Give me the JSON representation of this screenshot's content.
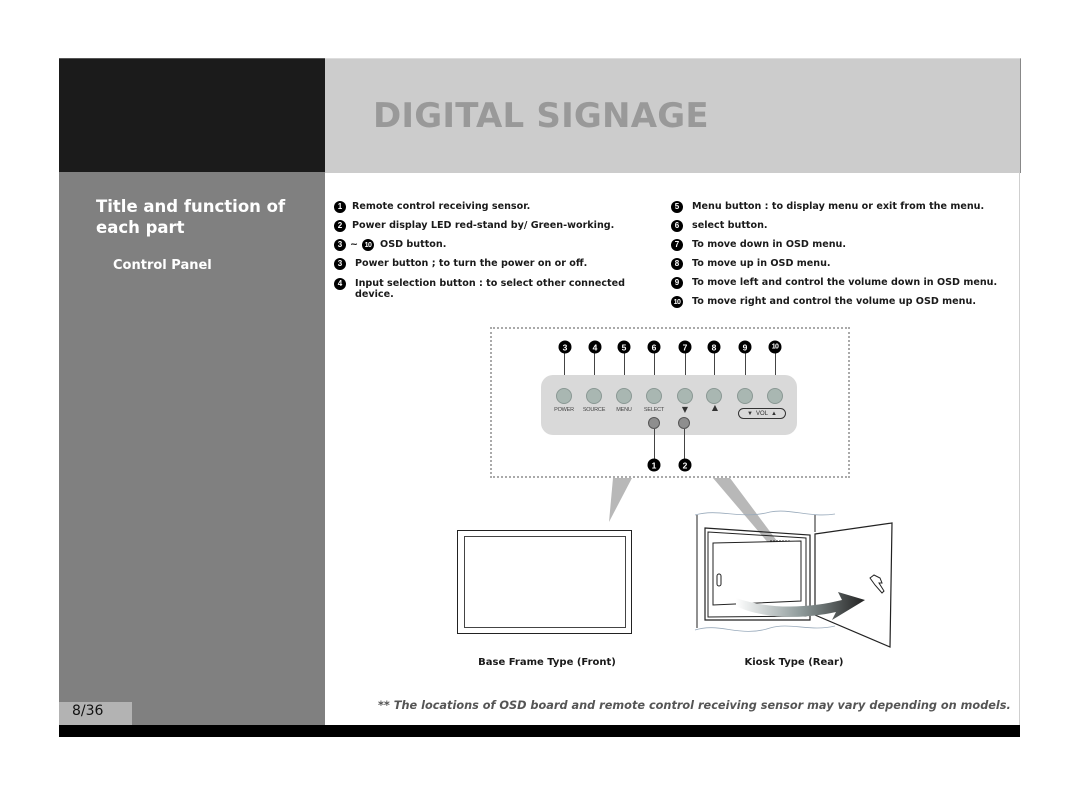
{
  "header": {
    "title": "DIGITAL SIGNAGE"
  },
  "sidebar": {
    "section_title": "Title and function of each part",
    "subsection": "Control Panel",
    "page_number": "8/36"
  },
  "descriptions": {
    "left": [
      {
        "badge": "1",
        "text": "Remote control receiving sensor."
      },
      {
        "badge": "2",
        "text": "Power display LED red-stand by/ Green-working."
      },
      {
        "badge": "3",
        "badge_end": "10",
        "separator": "~",
        "text": "OSD button."
      },
      {
        "badge": "3",
        "text": "Power button ; to turn the power on or off."
      },
      {
        "badge": "4",
        "text": "Input selection button : to select other connected device."
      }
    ],
    "right": [
      {
        "badge": "5",
        "text": "Menu button : to display menu or exit from the menu."
      },
      {
        "badge": "6",
        "text": "select button."
      },
      {
        "badge": "7",
        "text": "To move down in OSD menu."
      },
      {
        "badge": "8",
        "text": "To move up in OSD menu."
      },
      {
        "badge": "9",
        "text": "To move left and control the volume down in OSD menu."
      },
      {
        "badge": "10",
        "text": "To move right and control the volume up OSD menu."
      }
    ]
  },
  "control_panel": {
    "top_badges": [
      "3",
      "4",
      "5",
      "6",
      "7",
      "8",
      "9",
      "10"
    ],
    "button_labels": [
      "POWER",
      "SOURCE",
      "MENU",
      "SELECT",
      "▼",
      "▲"
    ],
    "vol_label": "VOL",
    "vol_down": "▼",
    "vol_up": "▲",
    "bottom_badges": [
      "1",
      "2"
    ]
  },
  "illustrations": {
    "front_caption": "Base Frame Type (Front)",
    "rear_caption": "Kiosk Type (Rear)"
  },
  "footer": {
    "note": "** The locations of OSD board and remote control receiving sensor may vary depending on models."
  }
}
